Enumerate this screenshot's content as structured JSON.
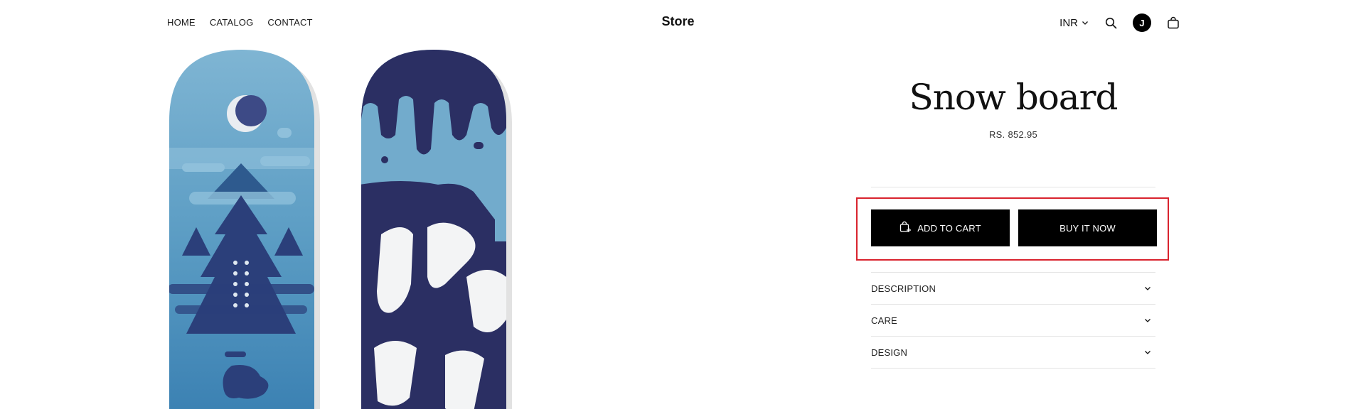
{
  "header": {
    "nav": [
      {
        "label": "HOME"
      },
      {
        "label": "CATALOG"
      },
      {
        "label": "CONTACT"
      }
    ],
    "brand": "Store",
    "currency": "INR",
    "avatar_initial": "J",
    "icons": [
      "chevron-down-icon",
      "search-icon",
      "cart-icon"
    ]
  },
  "product": {
    "title": "Snow board",
    "price": "RS. 852.95",
    "add_to_cart_label": "ADD TO CART",
    "buy_now_label": "BUY IT NOW",
    "accordion": [
      {
        "label": "DESCRIPTION"
      },
      {
        "label": "CARE"
      },
      {
        "label": "DESIGN"
      }
    ]
  },
  "colors": {
    "accent": "#000000",
    "highlight_border": "#d9232e",
    "board_light_blue": "#6fa9cb",
    "board_navy": "#2b2f63"
  }
}
